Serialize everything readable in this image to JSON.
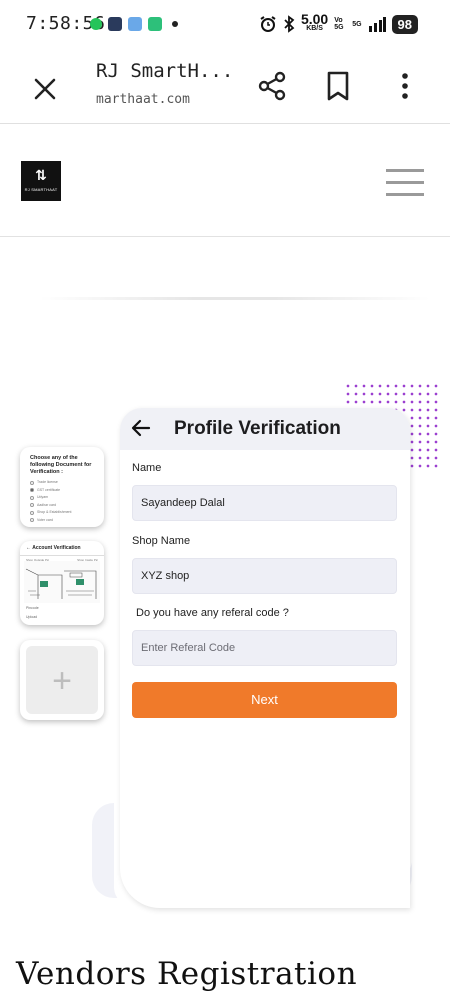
{
  "status_bar": {
    "time": "7:58:56",
    "speed_value": "5.00",
    "speed_unit": "KB/S",
    "network_a": "Vo 5G",
    "network_b": "5G",
    "battery": "98"
  },
  "browser": {
    "title": "RJ SmartH...",
    "url": "marthaat.com"
  },
  "site": {
    "logo_text": "RJ SMARTHAAT"
  },
  "thumbnails": {
    "document_prompt": "Choose any of the following Document for Verification :",
    "document_options": [
      "Trade license",
      "GST certificate",
      "Udyam",
      "Aadhar card",
      "Shop & Establishment",
      "Voter card"
    ],
    "account_title": "Account Verification",
    "account_sub_left": "Shop Outside Pic",
    "account_sub_right": "Shop Inside Pic",
    "account_foot_1": "Pincode",
    "account_foot_2": "Upload"
  },
  "form": {
    "title": "Profile Verification",
    "name_label": "Name",
    "name_value": "Sayandeep Dalal",
    "shop_label": "Shop Name",
    "shop_value": "XYZ shop",
    "referral_label": "Do you have any referal code ?",
    "referral_placeholder": "Enter Referal Code",
    "next_label": "Next"
  },
  "caption": "Vendors Registration",
  "colors": {
    "accent": "#f07a2a",
    "field_bg": "#eeeff6",
    "dots": "#9b3fd0"
  }
}
